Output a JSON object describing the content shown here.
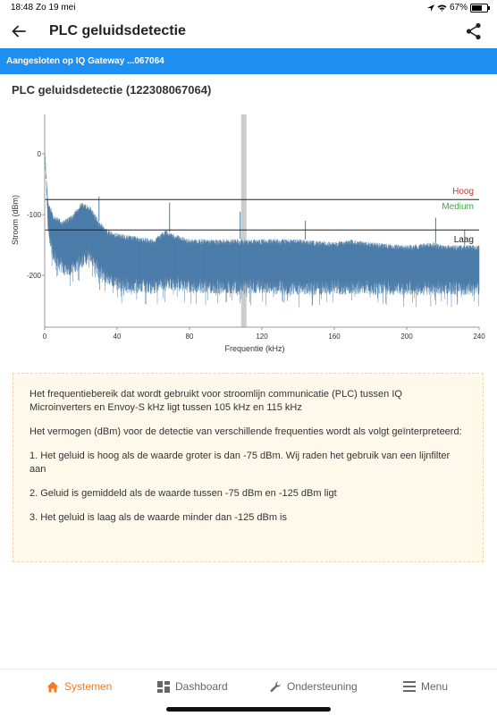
{
  "status_bar": {
    "time": "18:48",
    "date": "Zo 19 mei",
    "battery": "67%",
    "battery_level": 0.67
  },
  "header": {
    "title": "PLC geluidsdetectie"
  },
  "banner": {
    "text": "Aangesloten op IQ Gateway ...067064"
  },
  "section": {
    "title": "PLC geluidsdetectie (122308067064)"
  },
  "chart_data": {
    "type": "area",
    "xlabel": "Frequentie (kHz)",
    "ylabel": "Stroom (dBm)",
    "xlim": [
      0,
      240
    ],
    "ylim": [
      -285,
      65
    ],
    "x_ticks": [
      0,
      40,
      80,
      120,
      160,
      200,
      240
    ],
    "y_ticks": [
      0,
      -100,
      -200
    ],
    "series_color": "#4a7ba7",
    "highlight_band": {
      "x": 110,
      "color": "#cccccc"
    },
    "threshold_lines": [
      {
        "name": "Hoog",
        "value": -75,
        "color": "#c0392b"
      },
      {
        "name": "Medium",
        "value": -100,
        "color": "#2db33f"
      },
      {
        "name": "Laag",
        "value": -125,
        "color": "#222222"
      }
    ],
    "envelope": {
      "x": [
        0,
        1,
        2,
        5,
        10,
        15,
        20,
        25,
        30,
        35,
        40,
        50,
        60,
        67,
        70,
        80,
        90,
        100,
        110,
        120,
        140,
        160,
        170,
        180,
        200,
        215,
        220,
        240
      ],
      "upper": [
        0,
        -40,
        -80,
        -100,
        -110,
        -100,
        -80,
        -85,
        -110,
        -125,
        -130,
        -135,
        -140,
        -125,
        -130,
        -140,
        -140,
        -140,
        -140,
        -140,
        -140,
        -145,
        -140,
        -145,
        -150,
        -145,
        -150,
        -150
      ],
      "lower": [
        -5,
        -60,
        -140,
        -180,
        -200,
        -200,
        -190,
        -175,
        -205,
        -215,
        -225,
        -230,
        -230,
        -225,
        -225,
        -228,
        -230,
        -230,
        -230,
        -230,
        -232,
        -232,
        -232,
        -232,
        -232,
        -232,
        -232,
        -232
      ]
    },
    "spikes": [
      {
        "x": 30,
        "y": -70
      },
      {
        "x": 69,
        "y": -80
      },
      {
        "x": 108,
        "y": -95
      },
      {
        "x": 144,
        "y": -110
      },
      {
        "x": 216,
        "y": -105
      },
      {
        "x": 232,
        "y": -125
      }
    ]
  },
  "info": {
    "p1": "Het frequentiebereik dat wordt gebruikt voor stroomlijn communicatie (PLC) tussen IQ Microinverters en Envoy-S kHz ligt tussen 105 kHz en 115 kHz",
    "p2": "Het vermogen (dBm) voor de detectie van verschillende frequenties wordt als volgt geïnterpreteerd:",
    "p3": "1. Het geluid is hoog als de waarde groter is dan -75 dBm. Wij raden het gebruik van een lijnfilter aan",
    "p4": "2. Geluid is gemiddeld als de waarde tussen -75 dBm en -125 dBm ligt",
    "p5": "3. Het geluid is laag als de waarde minder dan -125 dBm is"
  },
  "nav": {
    "items": [
      {
        "label": "Systemen",
        "icon": "home-icon"
      },
      {
        "label": "Dashboard",
        "icon": "dashboard-icon"
      },
      {
        "label": "Ondersteuning",
        "icon": "wrench-icon"
      },
      {
        "label": "Menu",
        "icon": "menu-icon"
      }
    ],
    "active_color": "#f47b20"
  }
}
